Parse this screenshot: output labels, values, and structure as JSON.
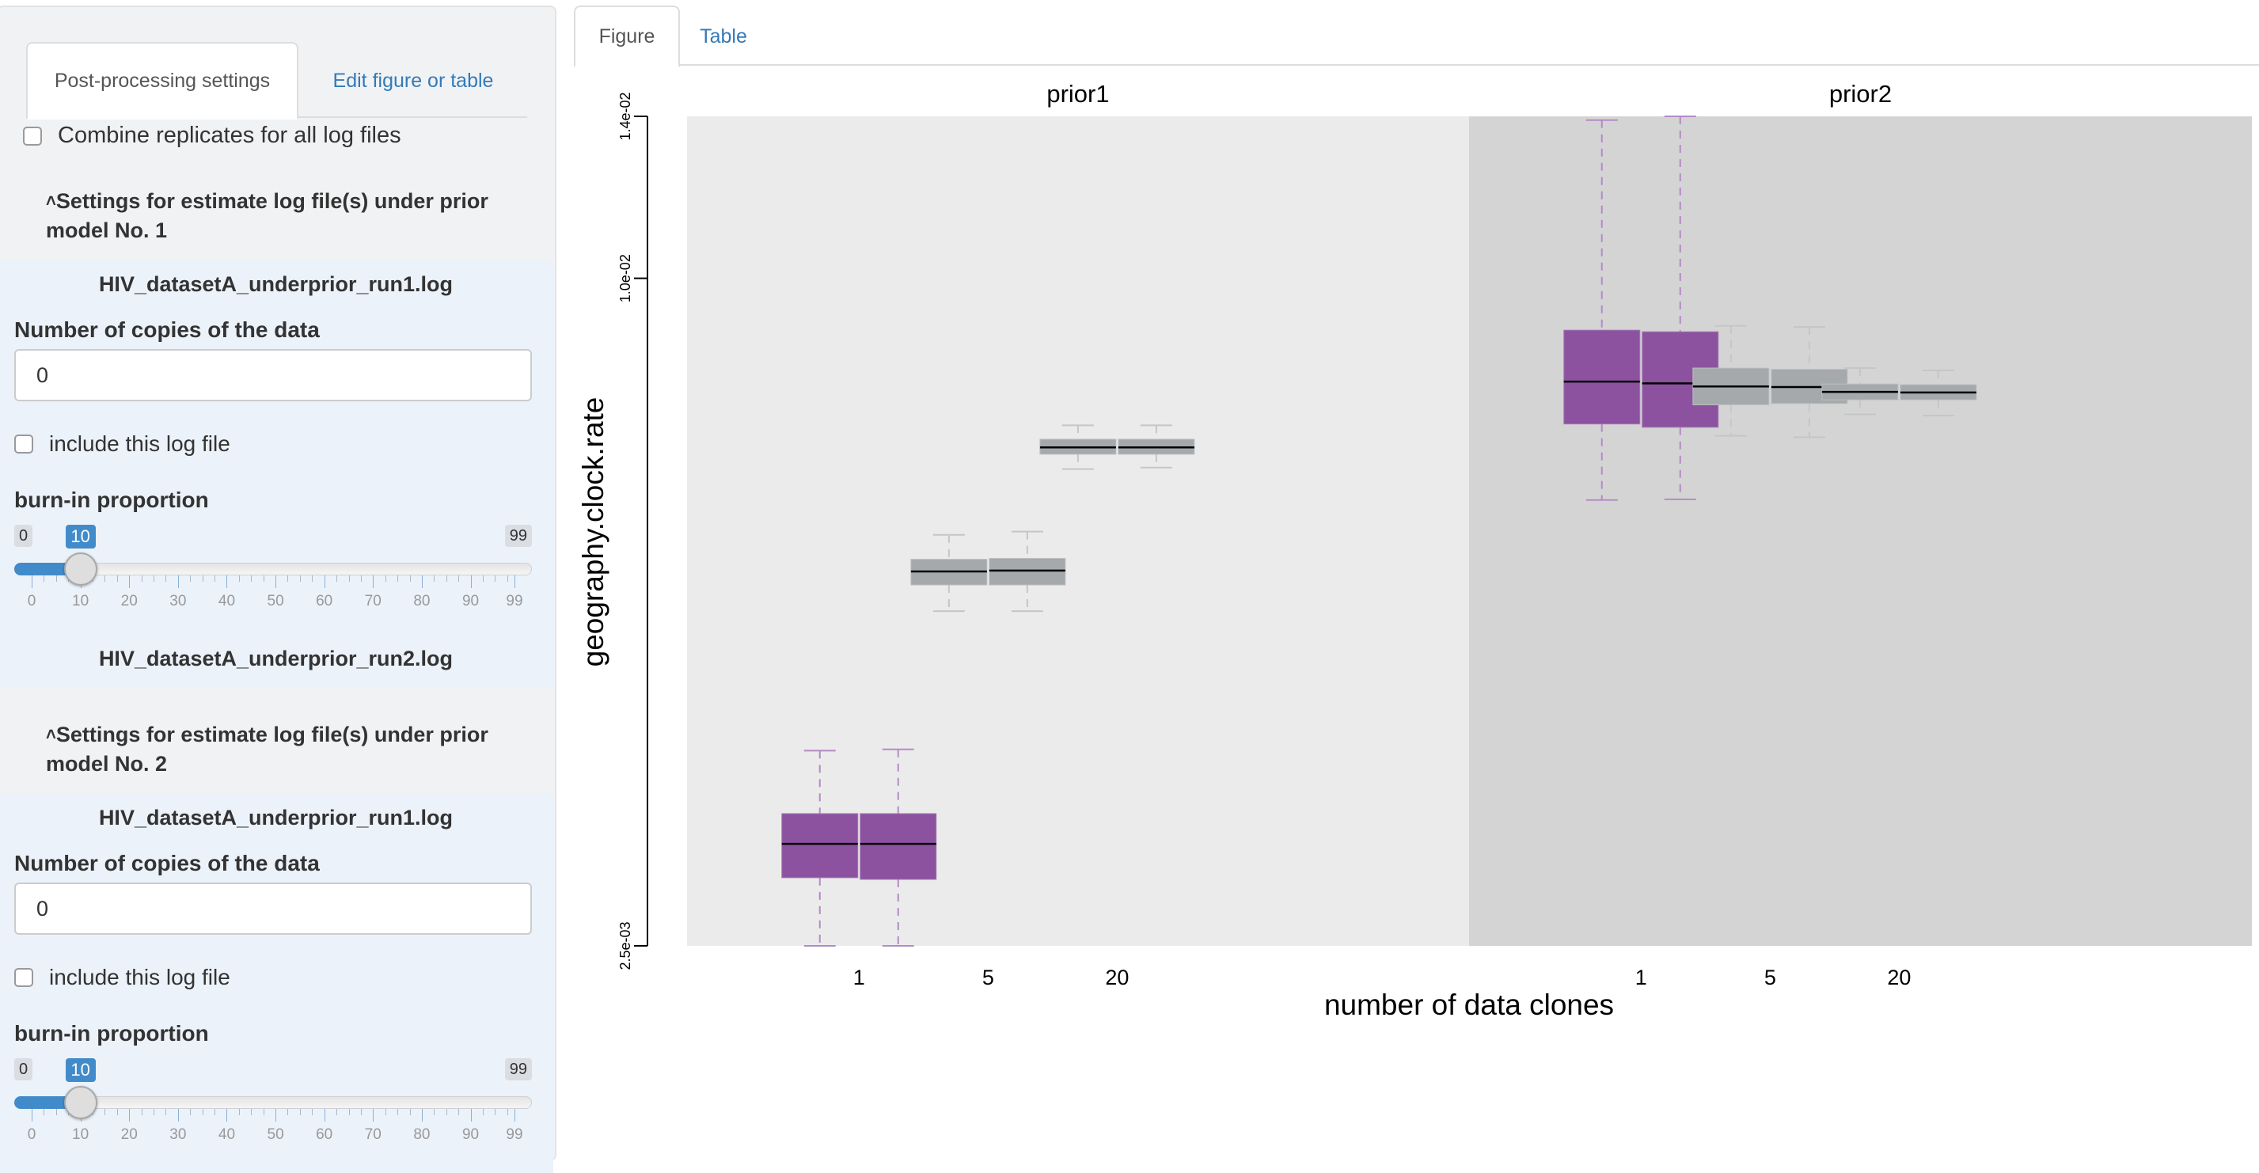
{
  "sidebar": {
    "tabs": [
      {
        "label": "Post-processing settings",
        "active": true
      },
      {
        "label": "Edit figure or table",
        "active": false
      }
    ],
    "combine_replicates": {
      "label": "Combine replicates for all log files",
      "checked": false
    },
    "priors": [
      {
        "heading": "Settings for estimate log file(s) under prior model No. 1",
        "caret": "^",
        "logs": [
          {
            "filename": "HIV_datasetA_underprior_run1.log",
            "copies_label": "Number of copies of the data",
            "copies_value": "0",
            "include_label": "include this log file",
            "include_checked": false,
            "burnin_label": "burn-in proportion",
            "burnin": {
              "min": "0",
              "max": "99",
              "value": "10",
              "tick_labels": [
                "0",
                "10",
                "20",
                "30",
                "40",
                "50",
                "60",
                "70",
                "80",
                "90",
                "99"
              ]
            }
          },
          {
            "filename": "HIV_datasetA_underprior_run2.log"
          }
        ]
      },
      {
        "heading": "Settings for estimate log file(s) under prior model No. 2",
        "caret": "^",
        "logs": [
          {
            "filename": "HIV_datasetA_underprior_run1.log",
            "copies_label": "Number of copies of the data",
            "copies_value": "0",
            "include_label": "include this log file",
            "include_checked": false,
            "burnin_label": "burn-in proportion",
            "burnin": {
              "min": "0",
              "max": "99",
              "value": "10",
              "tick_labels": [
                "0",
                "10",
                "20",
                "30",
                "40",
                "50",
                "60",
                "70",
                "80",
                "90",
                "99"
              ]
            }
          }
        ]
      }
    ]
  },
  "main": {
    "tabs": [
      {
        "label": "Figure",
        "active": true
      },
      {
        "label": "Table",
        "active": false
      }
    ]
  },
  "chart_data": {
    "type": "boxplot",
    "ylabel": "geography.clock.rate",
    "xlabel": "number of data clones",
    "yscale": "log",
    "ylim": [
      0.0025,
      0.014
    ],
    "yticks": [
      {
        "value": 0.014,
        "label": "1.4e-02"
      },
      {
        "value": 0.01,
        "label": "1.0e-02"
      },
      {
        "value": 0.0025,
        "label": "2.5e-03"
      }
    ],
    "categories": [
      "1",
      "5",
      "20"
    ],
    "colors": {
      "clone1": "#8c52a0",
      "other": "#a5a9ab",
      "panel_prior1": "#ebebeb",
      "panel_prior2": "#d4d4d4",
      "median": "#000000"
    },
    "panels": [
      {
        "title": "prior1",
        "groups": [
          {
            "category": "1",
            "replicates": [
              {
                "whisker_low": 0.0025,
                "q1": 0.00288,
                "median": 0.00309,
                "q3": 0.00329,
                "whisker_high": 0.00375
              },
              {
                "whisker_low": 0.0025,
                "q1": 0.00287,
                "median": 0.00309,
                "q3": 0.00329,
                "whisker_high": 0.00376
              }
            ]
          },
          {
            "category": "5",
            "replicates": [
              {
                "whisker_low": 0.00501,
                "q1": 0.00529,
                "median": 0.00544,
                "q3": 0.00558,
                "whisker_high": 0.00587
              },
              {
                "whisker_low": 0.00501,
                "q1": 0.00529,
                "median": 0.00545,
                "q3": 0.00559,
                "whisker_high": 0.00591
              }
            ]
          },
          {
            "category": "20",
            "replicates": [
              {
                "whisker_low": 0.00673,
                "q1": 0.00694,
                "median": 0.00704,
                "q3": 0.00716,
                "whisker_high": 0.00737
              },
              {
                "whisker_low": 0.00675,
                "q1": 0.00694,
                "median": 0.00704,
                "q3": 0.00716,
                "whisker_high": 0.00737
              }
            ]
          }
        ]
      },
      {
        "title": "prior2",
        "groups": [
          {
            "category": "1",
            "replicates": [
              {
                "whisker_low": 0.00631,
                "q1": 0.00739,
                "median": 0.00807,
                "q3": 0.00898,
                "whisker_high": 0.01389
              },
              {
                "whisker_low": 0.00632,
                "q1": 0.00734,
                "median": 0.00804,
                "q3": 0.00895,
                "whisker_high": 0.014
              }
            ]
          },
          {
            "category": "5",
            "replicates": [
              {
                "whisker_low": 0.00721,
                "q1": 0.00769,
                "median": 0.00799,
                "q3": 0.0083,
                "whisker_high": 0.00906
              },
              {
                "whisker_low": 0.00719,
                "q1": 0.00771,
                "median": 0.00798,
                "q3": 0.00828,
                "whisker_high": 0.00904
              }
            ]
          },
          {
            "category": "20",
            "replicates": [
              {
                "whisker_low": 0.00754,
                "q1": 0.00777,
                "median": 0.0079,
                "q3": 0.00803,
                "whisker_high": 0.0083
              },
              {
                "whisker_low": 0.00752,
                "q1": 0.00777,
                "median": 0.00789,
                "q3": 0.00802,
                "whisker_high": 0.00826
              }
            ]
          }
        ]
      }
    ]
  }
}
